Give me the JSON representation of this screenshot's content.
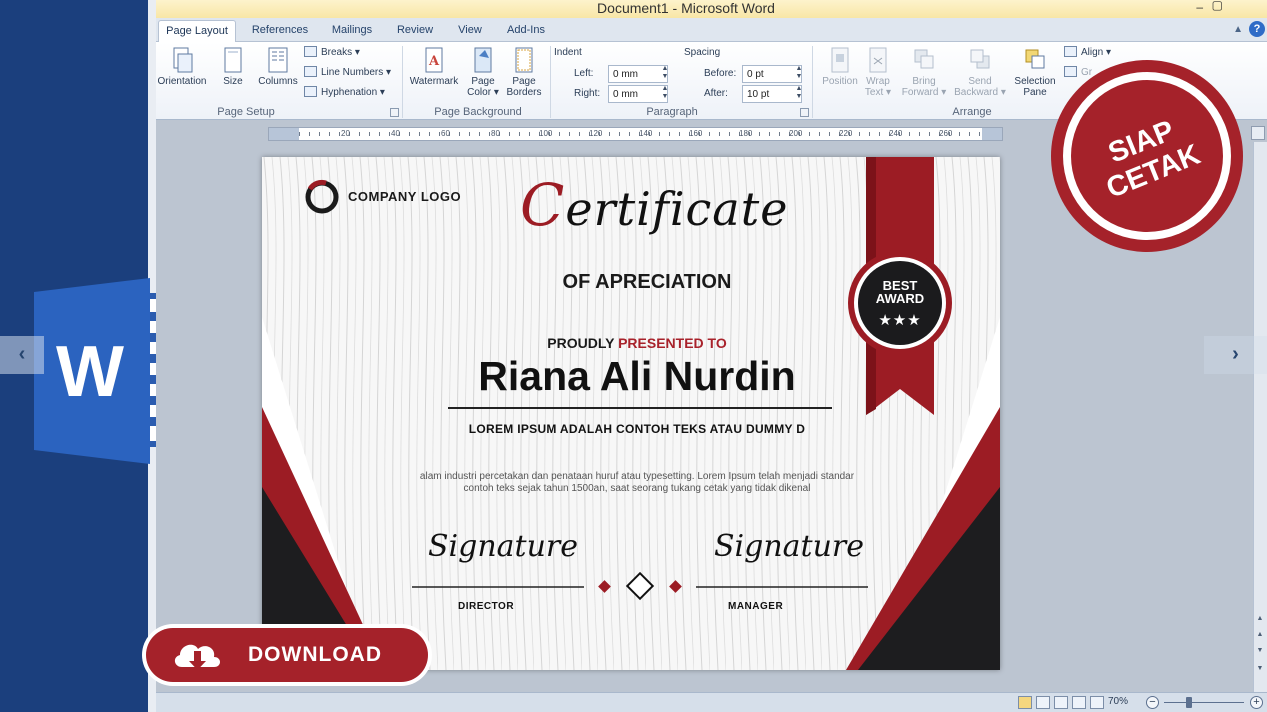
{
  "window": {
    "title": "Document1 - Microsoft Word",
    "min_glyph": "–",
    "restore_glyph": "▢"
  },
  "tabs": [
    "Page Layout",
    "References",
    "Mailings",
    "Review",
    "View",
    "Add-Ins"
  ],
  "active_tab": "Page Layout",
  "help_glyph": "?",
  "ribbon": {
    "page_setup": {
      "label": "Page Setup",
      "orientation": "Orientation",
      "size": "Size",
      "columns": "Columns",
      "breaks": "Breaks ▾",
      "line_numbers": "Line Numbers ▾",
      "hyphenation": "Hyphenation ▾"
    },
    "page_background": {
      "label": "Page Background",
      "watermark": "Watermark",
      "page_color_1": "Page",
      "page_color_2": "Color ▾",
      "page_borders_1": "Page",
      "page_borders_2": "Borders"
    },
    "paragraph": {
      "label": "Paragraph",
      "indent_label": "Indent",
      "spacing_label": "Spacing",
      "left_label": "Left:",
      "right_label": "Right:",
      "before_label": "Before:",
      "after_label": "After:",
      "left_value": "0 mm",
      "right_value": "0 mm",
      "before_value": "0 pt",
      "after_value": "10 pt"
    },
    "arrange": {
      "label": "Arrange",
      "position": "Position",
      "wrap_text_1": "Wrap",
      "wrap_text_2": "Text ▾",
      "bring_forward_1": "Bring",
      "bring_forward_2": "Forward ▾",
      "send_backward_1": "Send",
      "send_backward_2": "Backward ▾",
      "selection_pane_1": "Selection",
      "selection_pane_2": "Pane",
      "align": "Align ▾",
      "group": "Gr"
    }
  },
  "ruler_numbers": [
    "20",
    "40",
    "60",
    "80",
    "100",
    "120",
    "140",
    "160",
    "180",
    "200",
    "220",
    "240",
    "260"
  ],
  "certificate": {
    "logo_text": "COMPANY LOGO",
    "title_cap": "C",
    "title_rest": "ertificate",
    "subtitle": "OF APRECIATION",
    "presented_prefix": "PROUDLY ",
    "presented_highlight": "PRESENTED TO",
    "recipient": "Riana Ali Nurdin",
    "lorem_caps": "LOREM IPSUM ADALAH CONTOH TEKS ATAU DUMMY D",
    "lorem_body": "alam industri percetakan dan penataan huruf atau typesetting. Lorem Ipsum telah menjadi standar contoh teks sejak tahun 1500an, saat seorang tukang cetak yang tidak dikenal",
    "signature_left": "Signature",
    "signature_right": "Signature",
    "role_left": "DIRECTOR",
    "role_right": "MANAGER",
    "award_line1": "BEST",
    "award_line2": "AWARD",
    "award_stars": "★★★"
  },
  "status_bar": {
    "zoom": "70%",
    "zoom_minus": "−",
    "zoom_plus": "+",
    "zoom_level_percent": 70
  },
  "overlay": {
    "badge_line1": "SIAP",
    "badge_line2": "CETAK",
    "download_label": "DOWNLOAD",
    "nav_prev": "‹",
    "nav_next": "›"
  },
  "colors": {
    "accent_red": "#a5222a",
    "word_blue": "#1b3f7d",
    "word_logo_blue": "#2b5caf"
  },
  "icons": [
    "word-logo-icon",
    "cloud-download-icon",
    "help-icon",
    "star-icon"
  ]
}
